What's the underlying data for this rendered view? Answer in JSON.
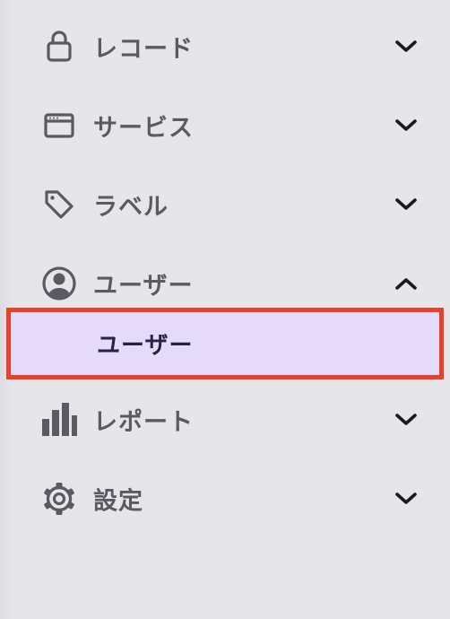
{
  "nav": {
    "items": [
      {
        "label": "レコード",
        "icon": "lock-icon",
        "expanded": false
      },
      {
        "label": "サービス",
        "icon": "browser-window-icon",
        "expanded": false
      },
      {
        "label": "ラベル",
        "icon": "tag-icon",
        "expanded": false
      },
      {
        "label": "ユーザー",
        "icon": "user-circle-icon",
        "expanded": true
      },
      {
        "label": "レポート",
        "icon": "bar-chart-icon",
        "expanded": false
      },
      {
        "label": "設定",
        "icon": "gear-icon",
        "expanded": false
      }
    ],
    "subitems": {
      "users": [
        {
          "label": "ユーザー",
          "selected": true
        }
      ]
    }
  },
  "colors": {
    "background": "#e6e5ea",
    "label": "#5b5a63",
    "icon": "#5b5a63",
    "chevron": "#1a1a1a",
    "selected_background": "#e6dafa",
    "selected_text": "#2a1f48",
    "highlight_border": "#e8402a"
  }
}
